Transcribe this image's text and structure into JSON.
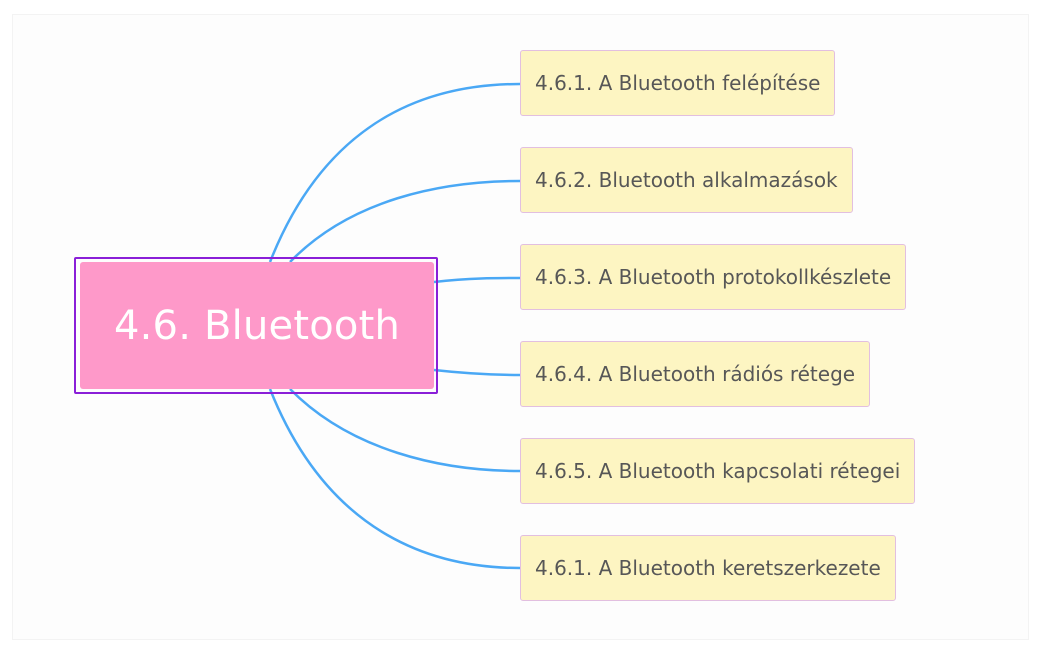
{
  "mindmap": {
    "root": {
      "label": "4.6. Bluetooth"
    },
    "children": [
      {
        "label": "4.6.1. A Bluetooth felépítése"
      },
      {
        "label": "4.6.2. Bluetooth alkalmazások"
      },
      {
        "label": "4.6.3. A Bluetooth protokollkészlete"
      },
      {
        "label": "4.6.4. A Bluetooth rádiós rétege"
      },
      {
        "label": "4.6.5. A Bluetooth kapcsolati rétegei"
      },
      {
        "label": "4.6.1. A Bluetooth keretszerkezete"
      }
    ]
  },
  "colors": {
    "root_fill": "#fe99c9",
    "root_selection_outline": "#8a1fd8",
    "child_fill": "#fdf5c2",
    "child_border": "#e2bfe0",
    "connector": "#4aa8f5"
  }
}
